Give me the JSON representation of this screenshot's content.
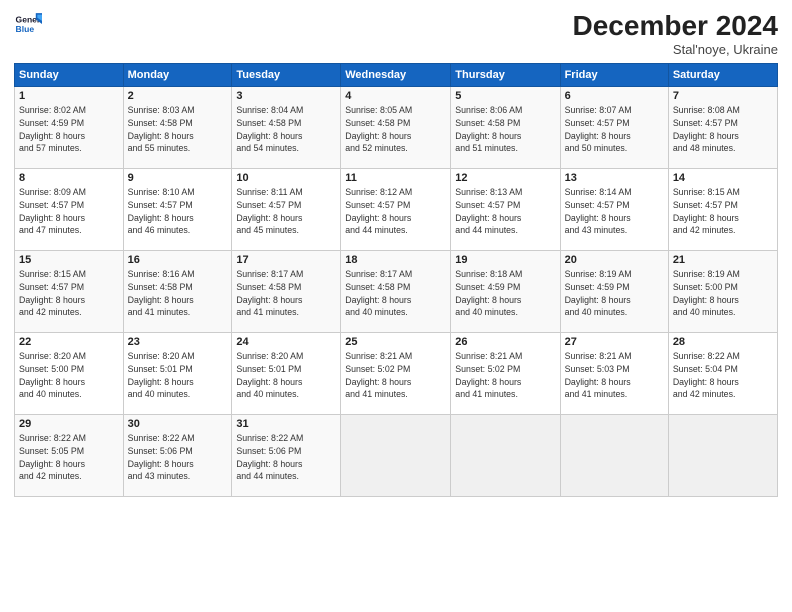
{
  "logo": {
    "line1": "General",
    "line2": "Blue"
  },
  "title": "December 2024",
  "subtitle": "Stal'noye, Ukraine",
  "header_days": [
    "Sunday",
    "Monday",
    "Tuesday",
    "Wednesday",
    "Thursday",
    "Friday",
    "Saturday"
  ],
  "weeks": [
    [
      {
        "day": "1",
        "info": "Sunrise: 8:02 AM\nSunset: 4:59 PM\nDaylight: 8 hours\nand 57 minutes."
      },
      {
        "day": "2",
        "info": "Sunrise: 8:03 AM\nSunset: 4:58 PM\nDaylight: 8 hours\nand 55 minutes."
      },
      {
        "day": "3",
        "info": "Sunrise: 8:04 AM\nSunset: 4:58 PM\nDaylight: 8 hours\nand 54 minutes."
      },
      {
        "day": "4",
        "info": "Sunrise: 8:05 AM\nSunset: 4:58 PM\nDaylight: 8 hours\nand 52 minutes."
      },
      {
        "day": "5",
        "info": "Sunrise: 8:06 AM\nSunset: 4:58 PM\nDaylight: 8 hours\nand 51 minutes."
      },
      {
        "day": "6",
        "info": "Sunrise: 8:07 AM\nSunset: 4:57 PM\nDaylight: 8 hours\nand 50 minutes."
      },
      {
        "day": "7",
        "info": "Sunrise: 8:08 AM\nSunset: 4:57 PM\nDaylight: 8 hours\nand 48 minutes."
      }
    ],
    [
      {
        "day": "8",
        "info": "Sunrise: 8:09 AM\nSunset: 4:57 PM\nDaylight: 8 hours\nand 47 minutes."
      },
      {
        "day": "9",
        "info": "Sunrise: 8:10 AM\nSunset: 4:57 PM\nDaylight: 8 hours\nand 46 minutes."
      },
      {
        "day": "10",
        "info": "Sunrise: 8:11 AM\nSunset: 4:57 PM\nDaylight: 8 hours\nand 45 minutes."
      },
      {
        "day": "11",
        "info": "Sunrise: 8:12 AM\nSunset: 4:57 PM\nDaylight: 8 hours\nand 44 minutes."
      },
      {
        "day": "12",
        "info": "Sunrise: 8:13 AM\nSunset: 4:57 PM\nDaylight: 8 hours\nand 44 minutes."
      },
      {
        "day": "13",
        "info": "Sunrise: 8:14 AM\nSunset: 4:57 PM\nDaylight: 8 hours\nand 43 minutes."
      },
      {
        "day": "14",
        "info": "Sunrise: 8:15 AM\nSunset: 4:57 PM\nDaylight: 8 hours\nand 42 minutes."
      }
    ],
    [
      {
        "day": "15",
        "info": "Sunrise: 8:15 AM\nSunset: 4:57 PM\nDaylight: 8 hours\nand 42 minutes."
      },
      {
        "day": "16",
        "info": "Sunrise: 8:16 AM\nSunset: 4:58 PM\nDaylight: 8 hours\nand 41 minutes."
      },
      {
        "day": "17",
        "info": "Sunrise: 8:17 AM\nSunset: 4:58 PM\nDaylight: 8 hours\nand 41 minutes."
      },
      {
        "day": "18",
        "info": "Sunrise: 8:17 AM\nSunset: 4:58 PM\nDaylight: 8 hours\nand 40 minutes."
      },
      {
        "day": "19",
        "info": "Sunrise: 8:18 AM\nSunset: 4:59 PM\nDaylight: 8 hours\nand 40 minutes."
      },
      {
        "day": "20",
        "info": "Sunrise: 8:19 AM\nSunset: 4:59 PM\nDaylight: 8 hours\nand 40 minutes."
      },
      {
        "day": "21",
        "info": "Sunrise: 8:19 AM\nSunset: 5:00 PM\nDaylight: 8 hours\nand 40 minutes."
      }
    ],
    [
      {
        "day": "22",
        "info": "Sunrise: 8:20 AM\nSunset: 5:00 PM\nDaylight: 8 hours\nand 40 minutes."
      },
      {
        "day": "23",
        "info": "Sunrise: 8:20 AM\nSunset: 5:01 PM\nDaylight: 8 hours\nand 40 minutes."
      },
      {
        "day": "24",
        "info": "Sunrise: 8:20 AM\nSunset: 5:01 PM\nDaylight: 8 hours\nand 40 minutes."
      },
      {
        "day": "25",
        "info": "Sunrise: 8:21 AM\nSunset: 5:02 PM\nDaylight: 8 hours\nand 41 minutes."
      },
      {
        "day": "26",
        "info": "Sunrise: 8:21 AM\nSunset: 5:02 PM\nDaylight: 8 hours\nand 41 minutes."
      },
      {
        "day": "27",
        "info": "Sunrise: 8:21 AM\nSunset: 5:03 PM\nDaylight: 8 hours\nand 41 minutes."
      },
      {
        "day": "28",
        "info": "Sunrise: 8:22 AM\nSunset: 5:04 PM\nDaylight: 8 hours\nand 42 minutes."
      }
    ],
    [
      {
        "day": "29",
        "info": "Sunrise: 8:22 AM\nSunset: 5:05 PM\nDaylight: 8 hours\nand 42 minutes."
      },
      {
        "day": "30",
        "info": "Sunrise: 8:22 AM\nSunset: 5:06 PM\nDaylight: 8 hours\nand 43 minutes."
      },
      {
        "day": "31",
        "info": "Sunrise: 8:22 AM\nSunset: 5:06 PM\nDaylight: 8 hours\nand 44 minutes."
      },
      {
        "day": "",
        "info": ""
      },
      {
        "day": "",
        "info": ""
      },
      {
        "day": "",
        "info": ""
      },
      {
        "day": "",
        "info": ""
      }
    ]
  ]
}
